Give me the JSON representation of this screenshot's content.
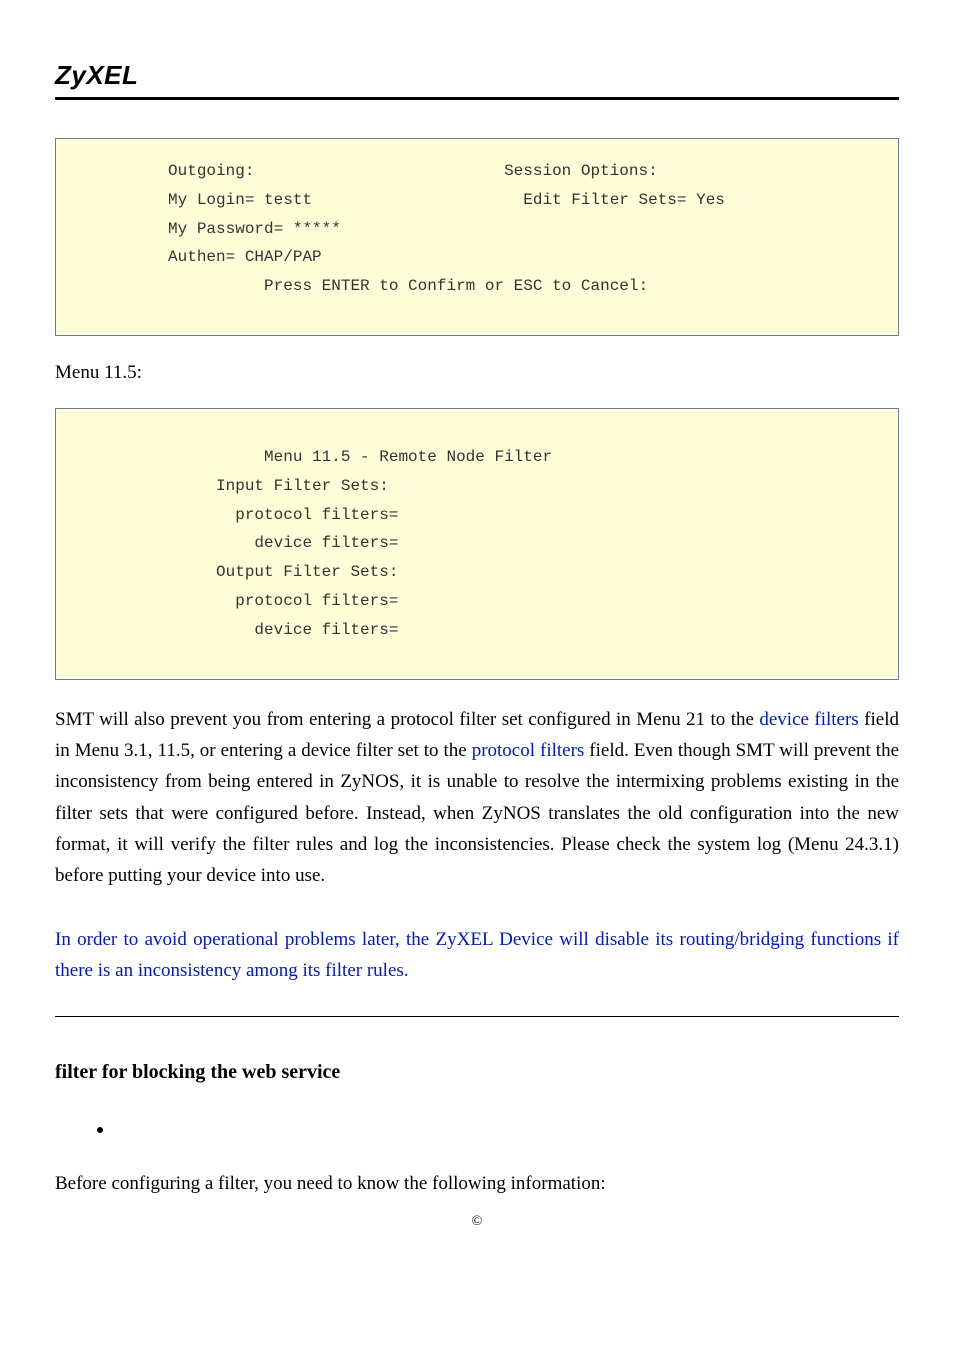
{
  "header": {
    "brand": "ZyXEL"
  },
  "terminal1": {
    "content": "          Outgoing:                          Session Options:\n          My Login= testt                      Edit Filter Sets= Yes\n          My Password= *****\n          Authen= CHAP/PAP\n                    Press ENTER to Confirm or ESC to Cancel:"
  },
  "caption1": "Menu 11.5:",
  "terminal2": {
    "content": "                    Menu 11.5 - Remote Node Filter\n               Input Filter Sets:\n                 protocol filters=\n                   device filters=\n               Output Filter Sets:\n                 protocol filters=\n                   device filters="
  },
  "paragraph": {
    "p1a": "SMT will also prevent you from entering a protocol filter set configured in Menu 21 to the ",
    "p1_link1": "device filters",
    "p1b": " field in Menu 3.1, 11.5, or entering a device filter set to the ",
    "p1_link2": "protocol filters",
    "p1c": " field. Even though SMT will prevent the inconsistency from being entered in ZyNOS, it is unable to resolve the intermixing problems existing in the filter sets that were configured before. Instead, when ZyNOS translates the old configuration into the new format, it will verify the filter rules and log the inconsistencies. Please check the system log (Menu 24.3.1) before putting your device into use."
  },
  "warning": "In order to avoid operational problems later, the ZyXEL Device will disable its routing/bridging functions if there is an inconsistency among its filter rules.",
  "heading": "filter for blocking the web service",
  "intro_line": "Before configuring a filter, you need to know the following information:",
  "footer": "©"
}
